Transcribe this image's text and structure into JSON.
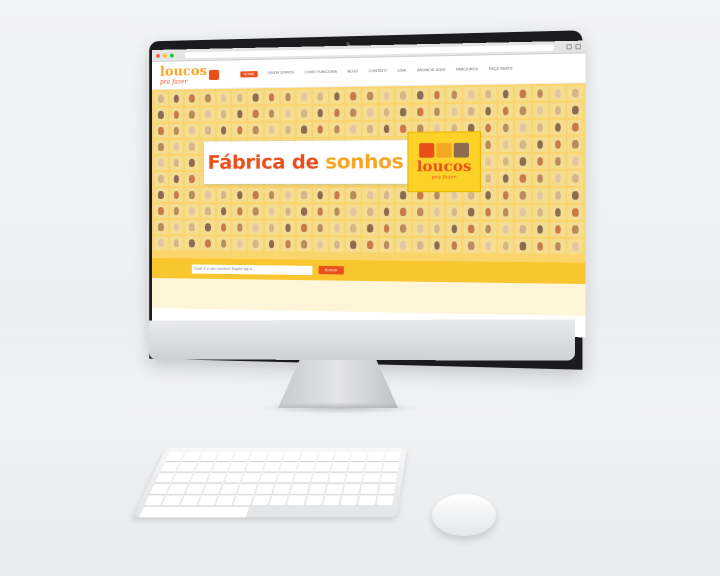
{
  "site": {
    "logo_text": "loucos",
    "logo_sub": "pra fazer",
    "nav": [
      {
        "label": "Home"
      },
      {
        "label": "Quem Somos"
      },
      {
        "label": "Como Funciona"
      },
      {
        "label": "Blog"
      },
      {
        "label": "Contato"
      },
      {
        "label": "Loja"
      },
      {
        "label": "Anuncie Aqui"
      },
      {
        "label": "Parceiros"
      },
      {
        "label": "Faça Parte"
      }
    ]
  },
  "hero": {
    "title_part1": "Fábrica de ",
    "title_part2": "sonhos",
    "logo_text": "loucos",
    "logo_sub": "pra fazer"
  },
  "search": {
    "placeholder": "Qual é o seu sonho? Digite aqui...",
    "button_label": "Buscar"
  },
  "colors": {
    "brand_orange": "#e94e1b",
    "brand_yellow": "#f9c62f"
  }
}
